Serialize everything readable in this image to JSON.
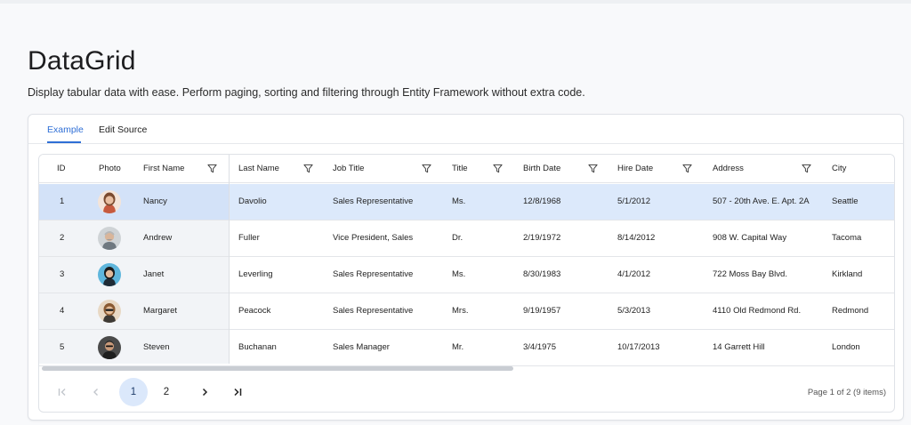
{
  "page": {
    "title": "DataGrid",
    "description": "Display tabular data with ease. Perform paging, sorting and filtering through Entity Framework without extra code."
  },
  "tabs": [
    {
      "label": "Example",
      "active": true
    },
    {
      "label": "Edit Source",
      "active": false
    }
  ],
  "grid": {
    "columns": [
      {
        "label": "ID",
        "filter": false
      },
      {
        "label": "Photo",
        "filter": false
      },
      {
        "label": "First Name",
        "filter": true
      },
      {
        "label": "Last Name",
        "filter": true
      },
      {
        "label": "Job Title",
        "filter": true
      },
      {
        "label": "Title",
        "filter": true
      },
      {
        "label": "Birth Date",
        "filter": true
      },
      {
        "label": "Hire Date",
        "filter": true
      },
      {
        "label": "Address",
        "filter": true
      },
      {
        "label": "City",
        "filter": false
      }
    ],
    "rows": [
      {
        "id": "1",
        "photo": "avatar-nancy",
        "first": "Nancy",
        "last": "Davolio",
        "job": "Sales Representative",
        "title": "Ms.",
        "birth": "12/8/1968",
        "hire": "5/1/2012",
        "address": "507 - 20th Ave. E. Apt. 2A",
        "city": "Seattle",
        "selected": true
      },
      {
        "id": "2",
        "photo": "avatar-andrew",
        "first": "Andrew",
        "last": "Fuller",
        "job": "Vice President, Sales",
        "title": "Dr.",
        "birth": "2/19/1972",
        "hire": "8/14/2012",
        "address": "908 W. Capital Way",
        "city": "Tacoma",
        "selected": false
      },
      {
        "id": "3",
        "photo": "avatar-janet",
        "first": "Janet",
        "last": "Leverling",
        "job": "Sales Representative",
        "title": "Ms.",
        "birth": "8/30/1983",
        "hire": "4/1/2012",
        "address": "722 Moss Bay Blvd.",
        "city": "Kirkland",
        "selected": false
      },
      {
        "id": "4",
        "photo": "avatar-margaret",
        "first": "Margaret",
        "last": "Peacock",
        "job": "Sales Representative",
        "title": "Mrs.",
        "birth": "9/19/1957",
        "hire": "5/3/2013",
        "address": "4110 Old Redmond Rd.",
        "city": "Redmond",
        "selected": false
      },
      {
        "id": "5",
        "photo": "avatar-steven",
        "first": "Steven",
        "last": "Buchanan",
        "job": "Sales Manager",
        "title": "Mr.",
        "birth": "3/4/1975",
        "hire": "10/17/2013",
        "address": "14 Garrett Hill",
        "city": "London",
        "selected": false
      }
    ]
  },
  "pager": {
    "first_icon": "first-page-icon",
    "prev_icon": "previous-page-icon",
    "pages": [
      "1",
      "2"
    ],
    "current_page": "1",
    "next_icon": "next-page-icon",
    "last_icon": "last-page-icon",
    "info": "Page 1 of 2 (9 items)"
  },
  "colors": {
    "accent": "#2f6fd6",
    "selected_row": "#dce9fb",
    "active_page": "#dbe8fb"
  }
}
